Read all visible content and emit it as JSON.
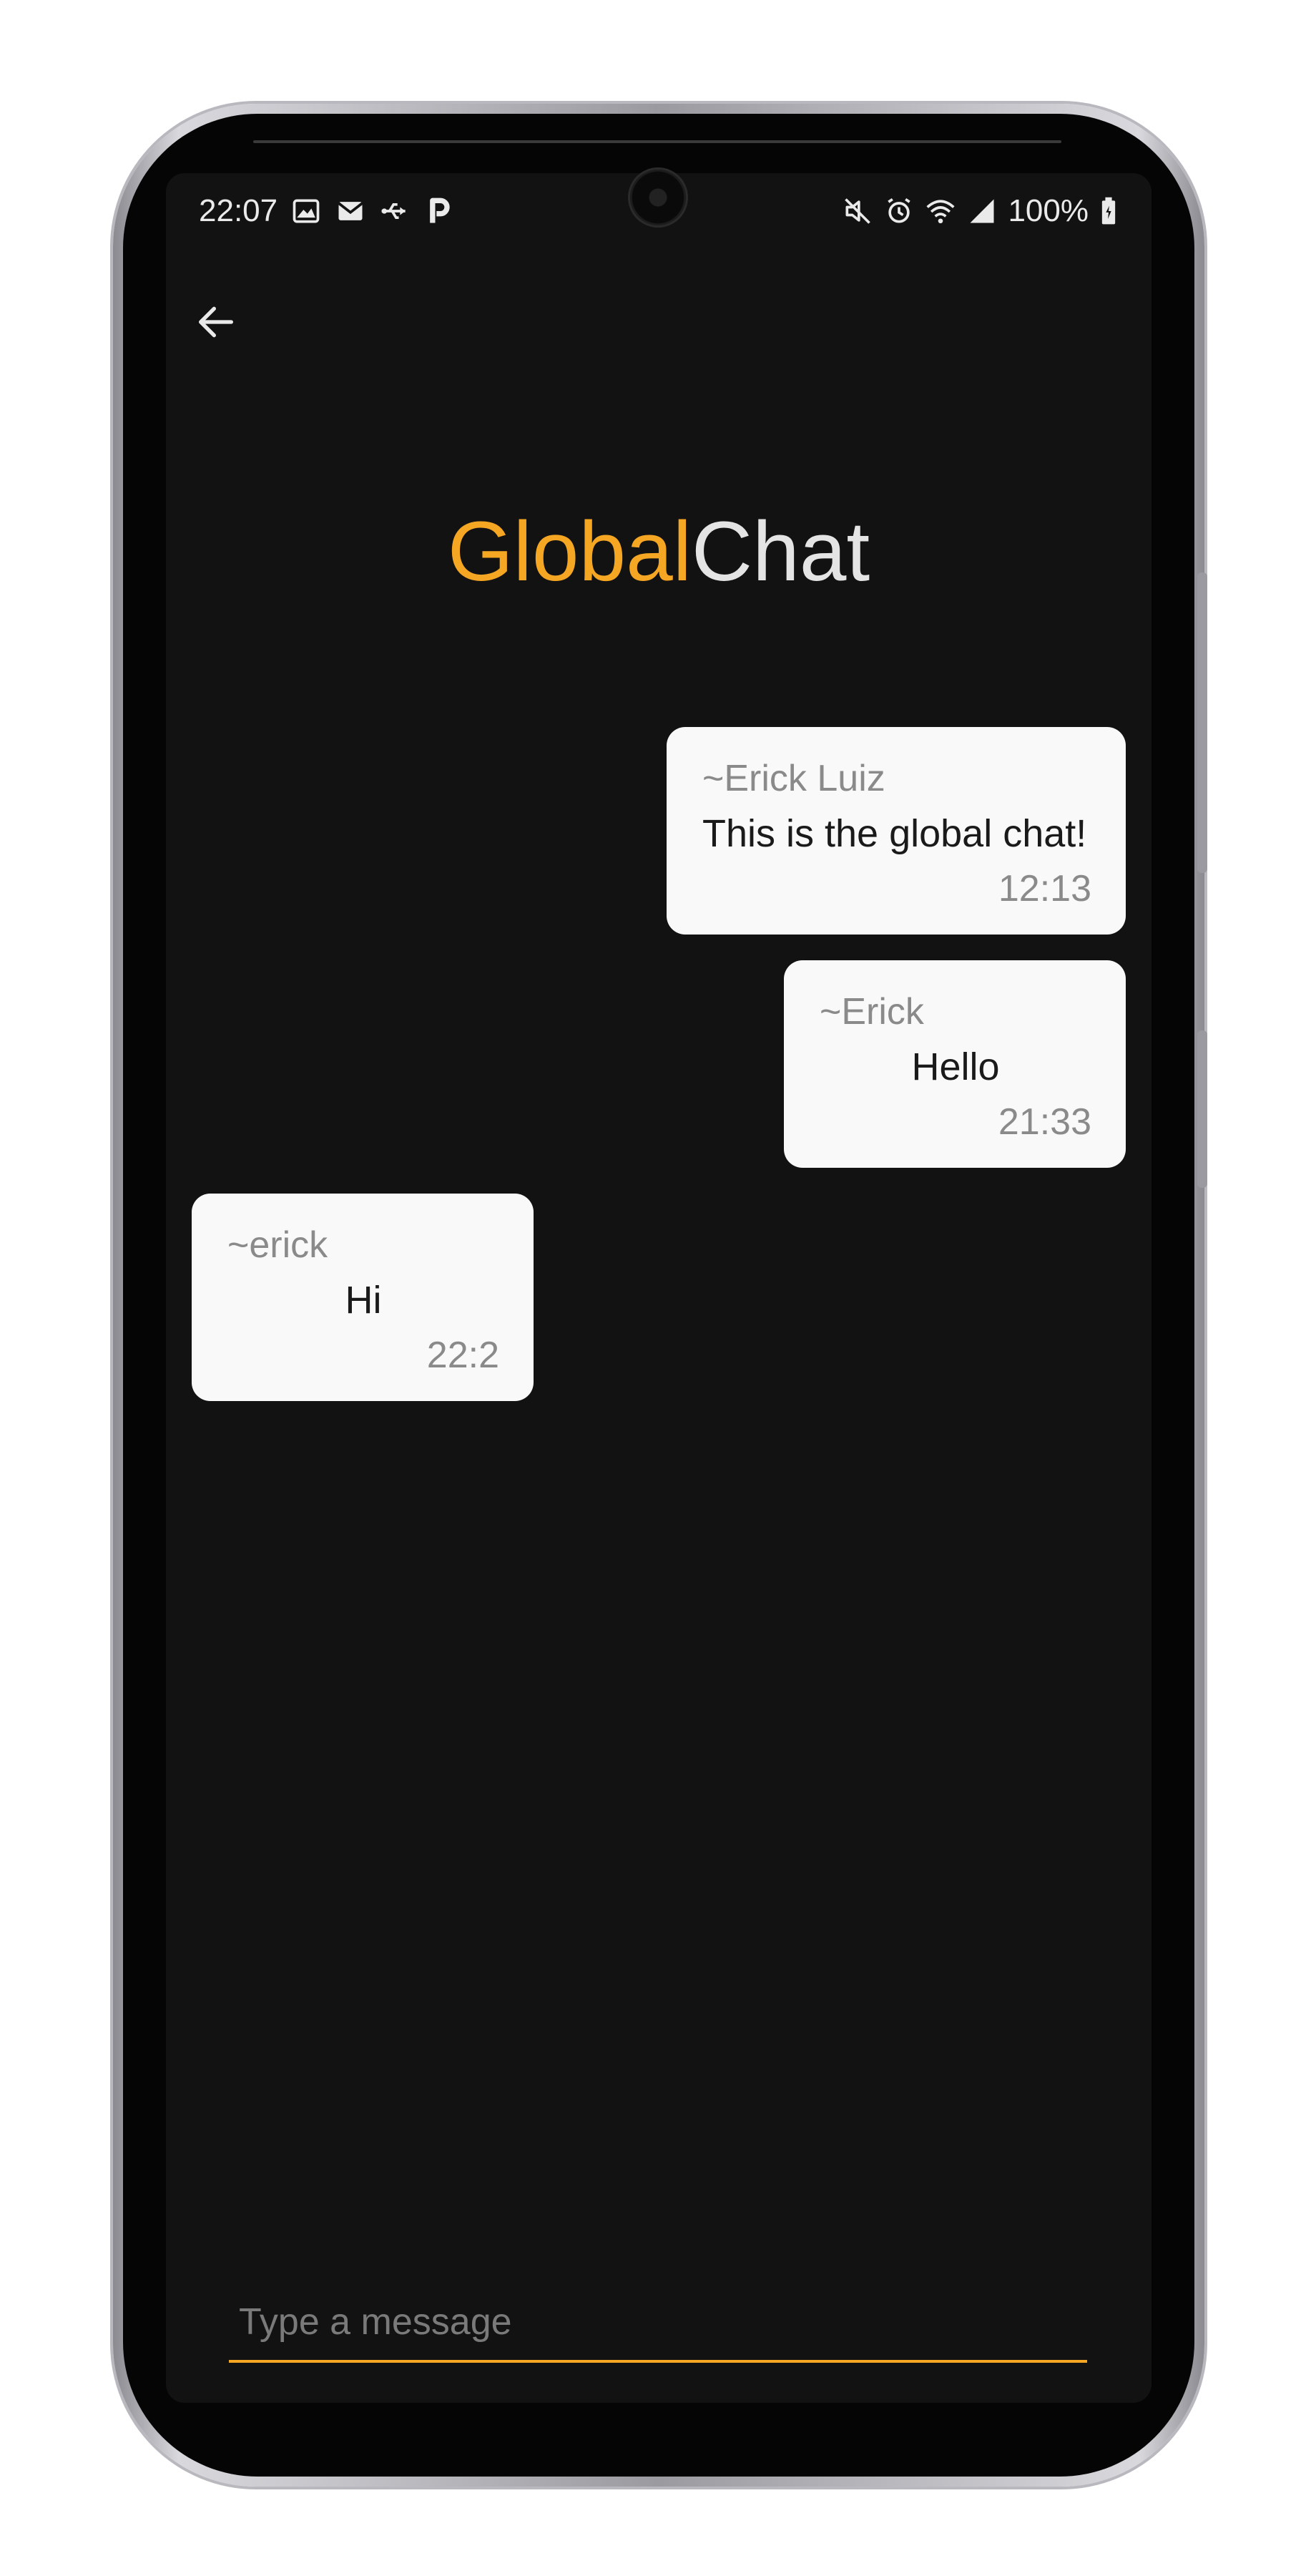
{
  "status_bar": {
    "time": "22:07",
    "battery": "100%",
    "left_icons": [
      "image-icon",
      "gmail-icon",
      "usb-icon",
      "p-app-icon"
    ],
    "right_icons": [
      "mute-icon",
      "alarm-icon",
      "wifi-icon",
      "signal-icon",
      "battery-icon"
    ]
  },
  "header": {
    "back_icon": "arrow-left-icon",
    "title_part1": "Global",
    "title_part2": "Chat"
  },
  "colors": {
    "accent": "#F5A623",
    "background": "#121212",
    "bubble": "#F9F9F9"
  },
  "messages": [
    {
      "sender": "~Erick Luiz",
      "text": "This is the global chat!",
      "time": "12:13",
      "side": "right"
    },
    {
      "sender": "~Erick",
      "text": "Hello",
      "time": "21:33",
      "side": "right"
    },
    {
      "sender": "~erick",
      "text": "Hi",
      "time": "22:2",
      "side": "left"
    }
  ],
  "composer": {
    "placeholder": "Type a message",
    "value": ""
  }
}
